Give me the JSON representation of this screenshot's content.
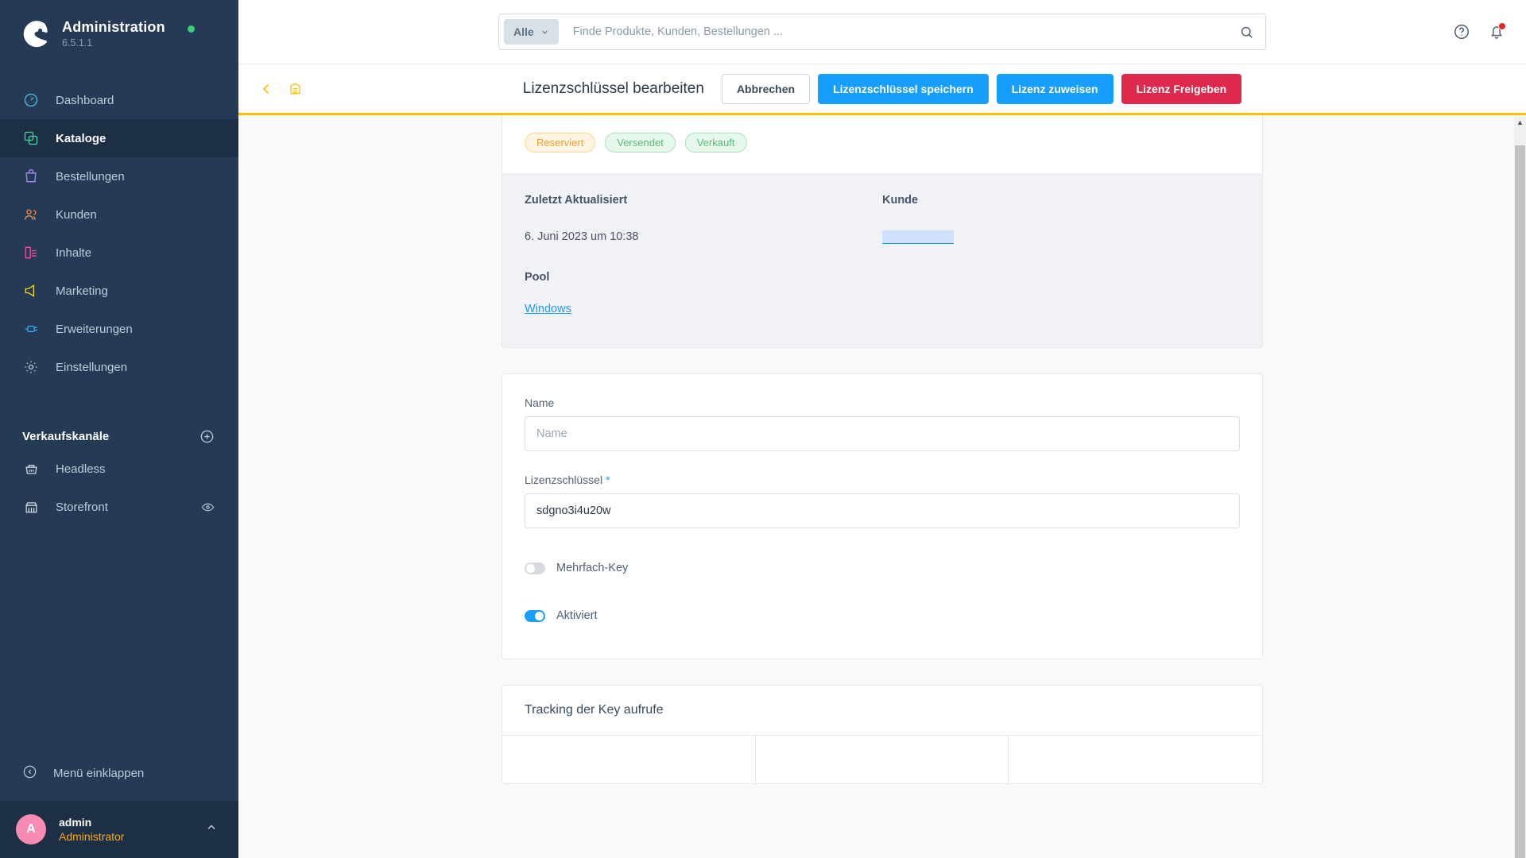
{
  "sidebar": {
    "brand": {
      "title": "Administration",
      "version": "6.5.1.1",
      "status": "online"
    },
    "nav": [
      {
        "label": "Dashboard",
        "icon": "dashboard-icon",
        "active": false
      },
      {
        "label": "Kataloge",
        "icon": "catalog-icon",
        "active": true
      },
      {
        "label": "Bestellungen",
        "icon": "orders-icon",
        "active": false
      },
      {
        "label": "Kunden",
        "icon": "customers-icon",
        "active": false
      },
      {
        "label": "Inhalte",
        "icon": "content-icon",
        "active": false
      },
      {
        "label": "Marketing",
        "icon": "marketing-icon",
        "active": false
      },
      {
        "label": "Erweiterungen",
        "icon": "extensions-icon",
        "active": false
      },
      {
        "label": "Einstellungen",
        "icon": "settings-icon",
        "active": false
      }
    ],
    "section": {
      "title": "Verkaufskanäle",
      "add_icon": "plus-circle-icon"
    },
    "channels": [
      {
        "label": "Headless",
        "icon": "basket-icon",
        "trailing_icon": ""
      },
      {
        "label": "Storefront",
        "icon": "storefront-icon",
        "trailing_icon": "eye-icon"
      }
    ],
    "collapse": {
      "label": "Menü einklappen",
      "icon": "collapse-icon"
    },
    "user": {
      "initial": "A",
      "name": "admin",
      "role": "Administrator",
      "caret": "chevron-up-icon"
    }
  },
  "topbar": {
    "search_scope": "Alle",
    "search_placeholder": "Finde Produkte, Kunden, Bestellungen ...",
    "search_value": "",
    "search_icon": "search-icon",
    "help_icon": "help-circle-icon",
    "notification_icon": "bell-icon",
    "has_notification": true
  },
  "smartbar": {
    "back_icon": "chevron-left-icon",
    "module_icon": "warehouse-icon",
    "title": "Lizenzschlüssel bearbeiten",
    "buttons": [
      {
        "label": "Abbrechen",
        "style": "ghost"
      },
      {
        "label": "Lizenzschlüssel speichern",
        "style": "primary"
      },
      {
        "label": "Lizenz zuweisen",
        "style": "primary"
      },
      {
        "label": "Lizenz Freigeben",
        "style": "danger"
      }
    ]
  },
  "info_card": {
    "badges": [
      {
        "label": "Reserviert",
        "tone": "warn"
      },
      {
        "label": "Versendet",
        "tone": "ok"
      },
      {
        "label": "Verkauft",
        "tone": "ok"
      }
    ],
    "labels": {
      "updated": "Zuletzt Aktualisiert",
      "customer": "Kunde",
      "pool": "Pool"
    },
    "values": {
      "updated": "6. Juni 2023 um 10:38",
      "customer": "",
      "pool": "Windows"
    }
  },
  "form_card": {
    "name": {
      "label": "Name",
      "placeholder": "Name",
      "value": ""
    },
    "license_key": {
      "label": "Lizenzschlüssel",
      "required_mark": "*",
      "value": "sdgno3i4u20w",
      "placeholder": ""
    },
    "toggles": [
      {
        "label": "Mehrfach-Key",
        "on": false
      },
      {
        "label": "Aktiviert",
        "on": true
      }
    ]
  },
  "tracking_card": {
    "title": "Tracking der Key aufrufe"
  },
  "colors": {
    "sidebar_bg": "#253a55",
    "sidebar_active": "#1d2f45",
    "accent_blue": "#189eff",
    "accent_yellow": "#ffc107",
    "danger_red": "#de294c",
    "avatar_pink": "#f88bb4",
    "role_orange": "#ffa809",
    "status_green": "#37d079"
  }
}
